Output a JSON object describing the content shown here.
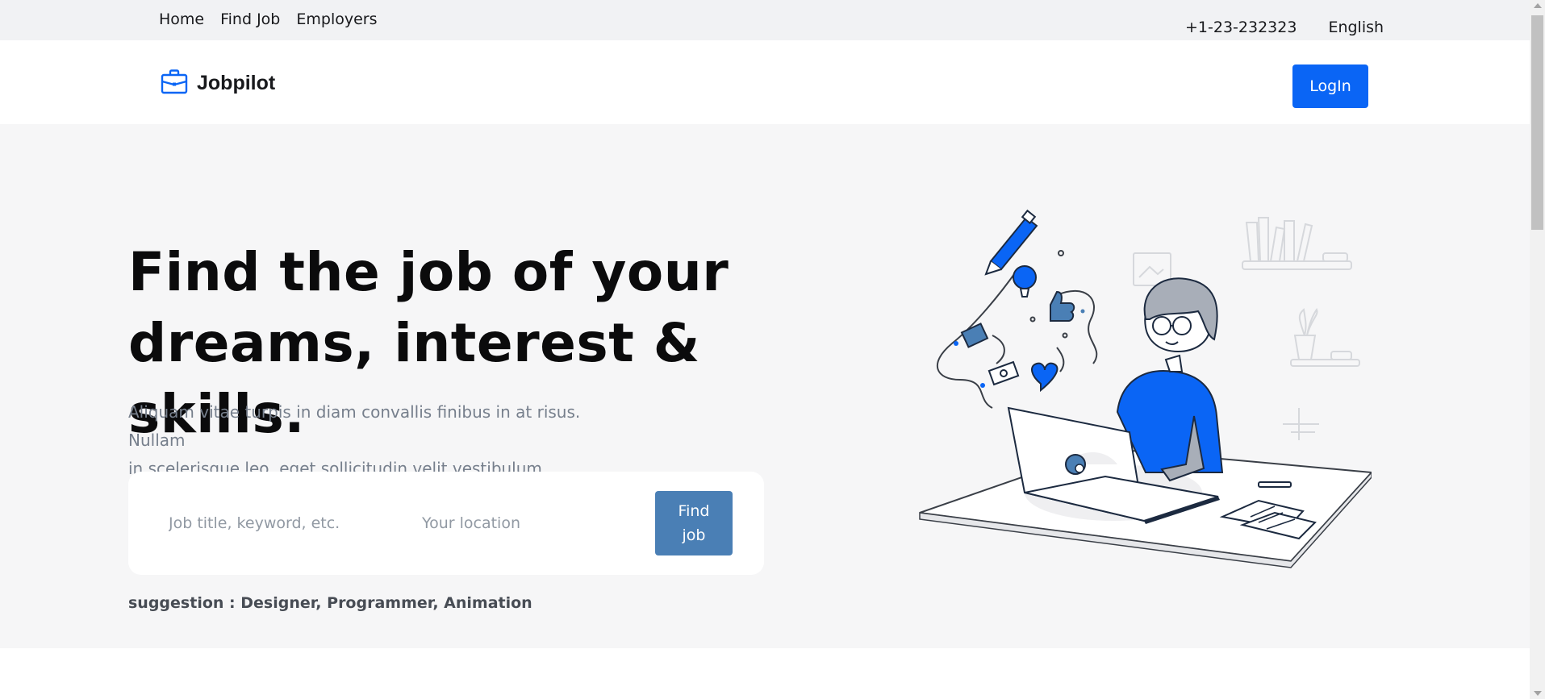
{
  "topbar": {
    "nav": [
      "Home",
      "Find Job",
      "Employers"
    ],
    "phone": "+1-23-232323",
    "language": "English"
  },
  "header": {
    "brand": "Jobpilot",
    "login_label": "LogIn"
  },
  "hero": {
    "title_line1": "Find the job of your",
    "title_line2": "dreams, interest & skills.",
    "description_line1": "Aliquam vitae turpis in diam convallis finibus in at risus. Nullam",
    "description_line2": "in scelerisque leo, eget sollicitudin velit vestibulum.",
    "search": {
      "job_placeholder": "Job title, keyword, etc.",
      "location_placeholder": "Your location",
      "button_line1": "Find",
      "button_line2": "job"
    },
    "suggestion": "suggestion : Designer, Programmer, Animation"
  },
  "colors": {
    "brand": "#0a65f5",
    "find_button": "#4a7fb5",
    "hero_background": "#f6f6f7",
    "topbar_background": "#f1f2f4"
  },
  "icons": [
    "briefcase-icon"
  ]
}
